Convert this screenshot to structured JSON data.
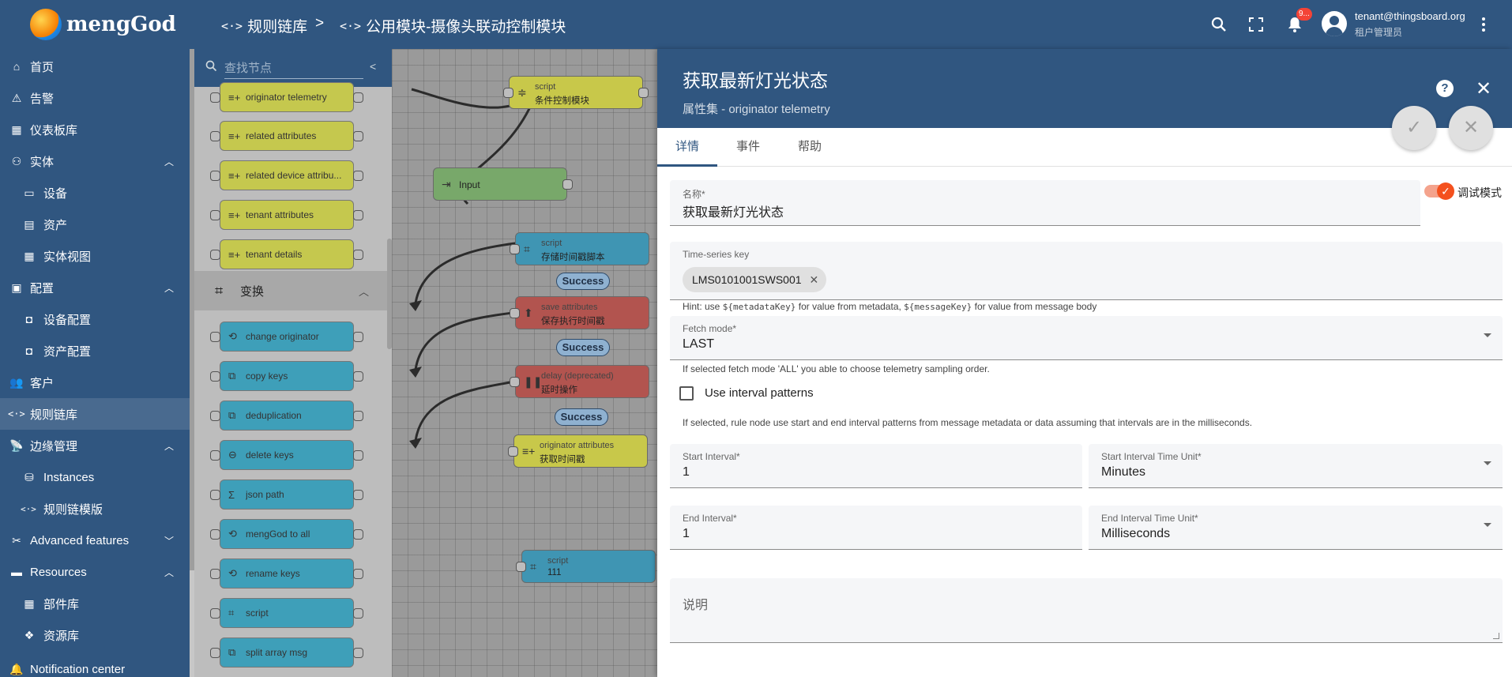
{
  "app": {
    "logo_text": "mengGod"
  },
  "breadcrumb": {
    "items": [
      {
        "label": "规则链库"
      },
      {
        "label": "公用模块-摄像头联动控制模块"
      }
    ],
    "separator": ">"
  },
  "header": {
    "notification_count": "9...",
    "user_email": "tenant@thingsboard.org",
    "user_role": "租户管理员"
  },
  "sidebar": {
    "items": [
      {
        "label": "首页",
        "icon": "home-icon"
      },
      {
        "label": "告警",
        "icon": "warning-icon"
      },
      {
        "label": "仪表板库",
        "icon": "dashboard-icon"
      },
      {
        "label": "实体",
        "icon": "entity-icon",
        "expanded": true
      },
      {
        "label": "设备",
        "icon": "device-icon"
      },
      {
        "label": "资产",
        "icon": "asset-icon"
      },
      {
        "label": "实体视图",
        "icon": "entity-view-icon"
      },
      {
        "label": "配置",
        "icon": "profile-icon",
        "expanded": true
      },
      {
        "label": "设备配置",
        "icon": "device-profile-icon"
      },
      {
        "label": "资产配置",
        "icon": "asset-profile-icon"
      },
      {
        "label": "客户",
        "icon": "customers-icon"
      },
      {
        "label": "规则链库",
        "icon": "rule-chain-icon",
        "active": true
      },
      {
        "label": "边缘管理",
        "icon": "edge-icon",
        "expanded": true
      },
      {
        "label": "Instances",
        "icon": "instances-icon"
      },
      {
        "label": "规则链模版",
        "icon": "rule-chain-template-icon"
      },
      {
        "label": "Advanced features",
        "icon": "advanced-features-icon",
        "expanded": false
      },
      {
        "label": "Resources",
        "icon": "folder-icon",
        "expanded": true
      },
      {
        "label": "部件库",
        "icon": "widgets-icon"
      },
      {
        "label": "资源库",
        "icon": "resources-icon"
      },
      {
        "label": "Notification center",
        "icon": "notification-center-icon"
      }
    ]
  },
  "library": {
    "search_placeholder": "查找节点",
    "enrichment_nodes": [
      {
        "label": "originator telemetry"
      },
      {
        "label": "related attributes"
      },
      {
        "label": "related device attribu..."
      },
      {
        "label": "tenant attributes"
      },
      {
        "label": "tenant details"
      }
    ],
    "transform_section": "变换",
    "transform_nodes": [
      {
        "label": "change originator"
      },
      {
        "label": "copy keys"
      },
      {
        "label": "deduplication"
      },
      {
        "label": "delete keys"
      },
      {
        "label": "json path"
      },
      {
        "label": "mengGod to all"
      },
      {
        "label": "rename keys"
      },
      {
        "label": "script"
      },
      {
        "label": "split array msg"
      }
    ]
  },
  "canvas": {
    "nodes": [
      {
        "type": "script",
        "name": "条件控制模块"
      },
      {
        "type": "",
        "name": "Input"
      },
      {
        "type": "script",
        "name": "存储时间戳脚本"
      },
      {
        "type": "save attributes",
        "name": "保存执行时间戳"
      },
      {
        "type": "delay (deprecated)",
        "name": "延时操作"
      },
      {
        "type": "originator attributes",
        "name": "获取时间戳"
      },
      {
        "type": "script",
        "name": "111"
      }
    ],
    "link_labels": [
      "Success",
      "Success",
      "Success"
    ]
  },
  "panel": {
    "title": "获取最新灯光状态",
    "subtitle": "属性集 - originator telemetry",
    "tabs": [
      "详情",
      "事件",
      "帮助"
    ],
    "name_label": "名称*",
    "name_value": "获取最新灯光状态",
    "debug_label": "调试模式",
    "ts_key_label": "Time-series key",
    "ts_key_chip": "LMS0101001SWS001",
    "hint_1": "Hint: use",
    "hint_1_code_a": "${metadataKey}",
    "hint_1_mid": "for value from metadata,",
    "hint_1_code_b": "${messageKey}",
    "hint_1_end": "for value from message body",
    "fetch_mode_label": "Fetch mode*",
    "fetch_mode_value": "LAST",
    "fetch_hint": "If selected fetch mode 'ALL' you able to choose telemetry sampling order.",
    "interval_patterns_label": "Use interval patterns",
    "interval_hint": "If selected, rule node use start and end interval patterns from message metadata or data assuming that intervals are in the milliseconds.",
    "start_interval_label": "Start Interval*",
    "start_interval_value": "1",
    "start_unit_label": "Start Interval Time Unit*",
    "start_unit_value": "Minutes",
    "end_interval_label": "End Interval*",
    "end_interval_value": "1",
    "end_unit_label": "End Interval Time Unit*",
    "end_unit_value": "Milliseconds",
    "description_label": "说明"
  }
}
